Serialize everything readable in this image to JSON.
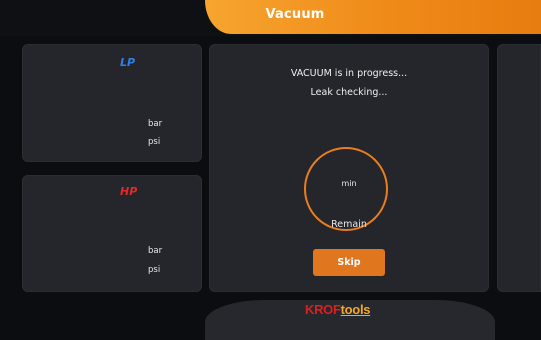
{
  "header": {
    "title": "Vacuum"
  },
  "lp_gauge": {
    "label": "LP",
    "unit_bar": "bar",
    "unit_psi": "psi",
    "color": "#2f7fe8"
  },
  "hp_gauge": {
    "label": "HP",
    "unit_bar": "bar",
    "unit_psi": "psi",
    "color": "#e02a2a"
  },
  "main": {
    "status_line1": "VACUUM is in progress...",
    "status_line2": "Leak checking...",
    "timer_unit": "min",
    "remain_label": "Remain",
    "skip_label": "Skip",
    "accent": "#e0761e"
  },
  "footer": {
    "logo_part1": "KROF",
    "logo_part2": "tools"
  }
}
